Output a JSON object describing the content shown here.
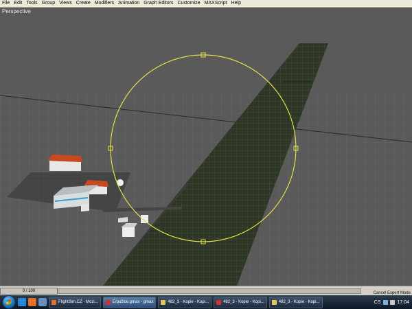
{
  "menu": [
    "File",
    "Edit",
    "Tools",
    "Group",
    "Views",
    "Create",
    "Modifiers",
    "Animation",
    "Graph Editors",
    "Customize",
    "MAXScript",
    "Help"
  ],
  "viewport": {
    "label": "Perspective"
  },
  "timeline": {
    "frame": "0 / 100"
  },
  "status": {
    "cancel": "Cancel Expert Mode"
  },
  "taskbar": {
    "tasks": [
      "FlightSim.CZ - Mozi...",
      "Erpužice.gmax - gmax",
      "482_3 - Kopie - Kopi...",
      "482_3 - Kopie - Kopi...",
      "482_3 - Kopie - Kopi..."
    ],
    "tray_label": "CS",
    "clock": "17:04"
  },
  "colors": {
    "menubar": "#ECE9D8",
    "viewport": "#5A5A5A",
    "gizmo": "#E6E24B",
    "runway": "#2E3626",
    "roof": "#C8491F",
    "taskbar": "#15202E"
  }
}
